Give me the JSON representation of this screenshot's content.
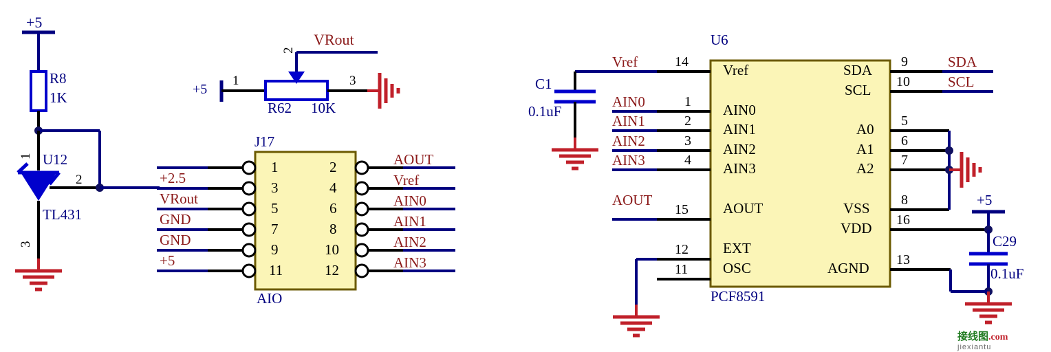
{
  "sheet": {
    "title": "PCF8591 ADC/DAC schematic",
    "background": "#ffffff"
  },
  "colors": {
    "wire_black": "#000000",
    "wire_blue": "#000080",
    "net_label_red": "#8b1a1a",
    "designator_blue": "#000080",
    "ic_body_fill": "#fbf5b7",
    "ic_body_stroke": "#6b5a00",
    "ground_red": "#c0202a",
    "symbol_blue": "#0000cc",
    "junction_dot": "#101060"
  },
  "power_rails": {
    "top_left": "+5",
    "pot_left": "+5",
    "right_vdd": "+5"
  },
  "tl431_block": {
    "resistor": {
      "designator": "R8",
      "value": "1K"
    },
    "shunt_ref": {
      "designator": "U12",
      "part": "TL431",
      "pin_1": "1",
      "pin_2": "2",
      "pin_3": "3"
    }
  },
  "potentiometer_block": {
    "designator": "R62",
    "value": "10K",
    "pin_1": "1",
    "pin_2": "2",
    "pin_3": "3",
    "wiper_net": "VRout",
    "supply_label": "+5"
  },
  "connector_j17": {
    "designator": "J17",
    "name": "AIO",
    "left_pins": [
      "1",
      "3",
      "5",
      "7",
      "9",
      "11"
    ],
    "right_pins": [
      "2",
      "4",
      "6",
      "8",
      "10",
      "12"
    ],
    "left_nets": [
      "+2.5",
      "VRout",
      "GND",
      "GND",
      "+5"
    ],
    "right_nets": [
      "AOUT",
      "Vref",
      "AIN0",
      "AIN1",
      "AIN2",
      "AIN3"
    ]
  },
  "ic_u6": {
    "designator": "U6",
    "part": "PCF8591",
    "left_pin_names": [
      "Vref",
      "AIN0",
      "AIN1",
      "AIN2",
      "AIN3",
      "AOUT",
      "EXT",
      "OSC"
    ],
    "left_pin_numbers": [
      "14",
      "1",
      "2",
      "3",
      "4",
      "15",
      "12",
      "11"
    ],
    "left_nets": [
      "Vref",
      "AIN0",
      "AIN1",
      "AIN2",
      "AIN3",
      "AOUT",
      "",
      ""
    ],
    "right_pin_names": [
      "SDA",
      "SCL",
      "A0",
      "A1",
      "A2",
      "VSS",
      "VDD",
      "AGND"
    ],
    "right_pin_numbers": [
      "9",
      "10",
      "5",
      "6",
      "7",
      "8",
      "16",
      "13"
    ],
    "right_nets": [
      "SDA",
      "SCL",
      "",
      "",
      "",
      "",
      "",
      ""
    ]
  },
  "capacitors": {
    "c1": {
      "designator": "C1",
      "value": "0.1uF"
    },
    "c29": {
      "designator": "C29",
      "value": "0.1uF"
    }
  },
  "watermark": {
    "cn": "接线图",
    "pinyin": "jiexiantu",
    "tld": ".com"
  }
}
